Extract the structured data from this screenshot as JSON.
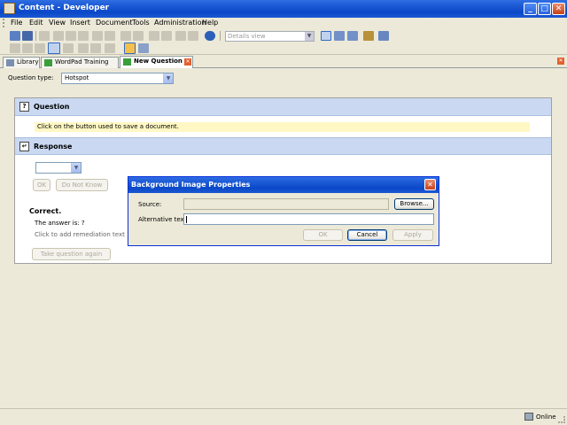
{
  "window": {
    "title": "Content - Developer"
  },
  "menu": [
    "File",
    "Edit",
    "View",
    "Insert",
    "Document",
    "Tools",
    "Administration",
    "Help"
  ],
  "toolbar": {
    "view_select": "Details view"
  },
  "tabs": [
    {
      "label": "Library",
      "active": false
    },
    {
      "label": "WordPad Training",
      "active": false
    },
    {
      "label": "New Question",
      "active": true
    }
  ],
  "question_type": {
    "label": "Question type:",
    "value": "Hotspot"
  },
  "question": {
    "header": "Question",
    "prompt": "Click on the button used to save a document."
  },
  "response": {
    "header": "Response",
    "ok_label": "OK",
    "dont_know_label": "Do Not Know"
  },
  "feedback": {
    "title": "Correct.",
    "answer": "The answer is: ?",
    "remediation": "Click to add remediation text",
    "retake_label": "Take question again"
  },
  "dialog": {
    "title": "Background Image Properties",
    "source_label": "Source:",
    "source_value": "",
    "browse_label": "Browse...",
    "alt_label": "Alternative text:",
    "alt_value": "",
    "ok_label": "OK",
    "cancel_label": "Cancel",
    "apply_label": "Apply"
  },
  "status": {
    "text": "Online"
  },
  "colors": {
    "titlebar": "#0a48c8",
    "prompt_highlight": "#fff8c4",
    "section_header": "#cad9f1"
  }
}
